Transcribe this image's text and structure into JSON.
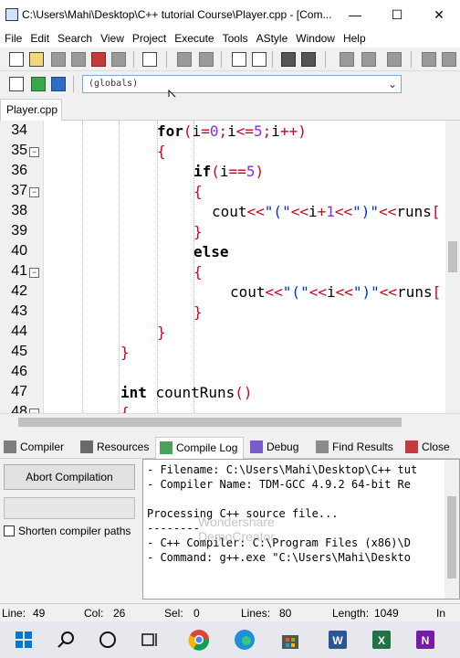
{
  "window": {
    "title": "C:\\Users\\Mahi\\Desktop\\C++ tutorial Course\\Player.cpp - [Com...",
    "minimize_glyph": "—",
    "maximize_glyph": "☐",
    "close_glyph": "✕"
  },
  "menu": [
    "File",
    "Edit",
    "Search",
    "View",
    "Project",
    "Execute",
    "Tools",
    "AStyle",
    "Window",
    "Help"
  ],
  "scope_selector": {
    "value": "(globals)"
  },
  "file_tab": {
    "label": "Player.cpp"
  },
  "editor": {
    "lines": [
      {
        "num": "34",
        "fold": false,
        "code": [
          [
            "kw",
            "for"
          ],
          [
            "sym",
            "("
          ],
          [
            "t",
            "i"
          ],
          [
            "sym",
            "="
          ],
          [
            "num",
            "0"
          ],
          [
            "sym",
            ";"
          ],
          [
            "t",
            "i"
          ],
          [
            "sym",
            "<="
          ],
          [
            "num",
            "5"
          ],
          [
            "sym",
            ";"
          ],
          [
            "t",
            "i"
          ],
          [
            "sym",
            "++)"
          ]
        ]
      },
      {
        "num": "35",
        "fold": true,
        "code": [
          [
            "sym",
            "{"
          ]
        ]
      },
      {
        "num": "36",
        "fold": false,
        "code": [
          [
            "kw",
            "if"
          ],
          [
            "sym",
            "("
          ],
          [
            "t",
            "i"
          ],
          [
            "sym",
            "=="
          ],
          [
            "num",
            "5"
          ],
          [
            "sym",
            ")"
          ]
        ]
      },
      {
        "num": "37",
        "fold": true,
        "code": [
          [
            "sym",
            "{"
          ]
        ]
      },
      {
        "num": "38",
        "fold": false,
        "code": [
          [
            "t",
            "cout"
          ],
          [
            "sym",
            "<<"
          ],
          [
            "str",
            "\"(\""
          ],
          [
            "sym",
            "<<"
          ],
          [
            "t",
            "i"
          ],
          [
            "sym",
            "+"
          ],
          [
            "num",
            "1"
          ],
          [
            "sym",
            "<<"
          ],
          [
            "str",
            "\")\""
          ],
          [
            "sym",
            "<<"
          ],
          [
            "t",
            "runs"
          ],
          [
            "sym",
            "["
          ]
        ]
      },
      {
        "num": "39",
        "fold": false,
        "code": [
          [
            "sym",
            "}"
          ]
        ]
      },
      {
        "num": "40",
        "fold": false,
        "code": [
          [
            "kw",
            "else"
          ]
        ]
      },
      {
        "num": "41",
        "fold": true,
        "code": [
          [
            "sym",
            "{"
          ]
        ]
      },
      {
        "num": "42",
        "fold": false,
        "code": [
          [
            "t",
            "cout"
          ],
          [
            "sym",
            "<<"
          ],
          [
            "str",
            "\"(\""
          ],
          [
            "sym",
            "<<"
          ],
          [
            "t",
            "i"
          ],
          [
            "sym",
            "<<"
          ],
          [
            "str",
            "\")\""
          ],
          [
            "sym",
            "<<"
          ],
          [
            "t",
            "runs"
          ],
          [
            "sym",
            "["
          ]
        ]
      },
      {
        "num": "43",
        "fold": false,
        "code": [
          [
            "sym",
            "}"
          ]
        ]
      },
      {
        "num": "44",
        "fold": false,
        "code": [
          [
            "sym",
            "}"
          ]
        ]
      },
      {
        "num": "45",
        "fold": false,
        "code": [
          [
            "sym",
            "}"
          ]
        ]
      },
      {
        "num": "46",
        "fold": false,
        "code": []
      },
      {
        "num": "47",
        "fold": false,
        "code": [
          [
            "kw",
            "int"
          ],
          [
            "t",
            " countRuns"
          ],
          [
            "sym",
            "()"
          ]
        ]
      },
      {
        "num": "48",
        "fold": true,
        "code": [
          [
            "sym",
            "{"
          ]
        ]
      }
    ]
  },
  "panel_tabs": [
    "Compiler",
    "Resources",
    "Compile Log",
    "Debug",
    "Find Results",
    "Close"
  ],
  "compile_panel": {
    "abort_label": "Abort Compilation",
    "shorten_label": "Shorten compiler paths"
  },
  "log_lines": [
    "- Filename: C:\\Users\\Mahi\\Desktop\\C++ tut",
    "- Compiler Name: TDM-GCC 4.9.2 64-bit Re",
    "",
    "Processing C++ source file...",
    "--------",
    "- C++ Compiler: C:\\Program Files (x86)\\D",
    "- Command: g++.exe \"C:\\Users\\Mahi\\Deskto"
  ],
  "watermark": {
    "line1": "Wondershare",
    "line2": "DemoCreator"
  },
  "status": {
    "line_label": "Line:",
    "line_value": "49",
    "col_label": "Col:",
    "col_value": "26",
    "sel_label": "Sel:",
    "sel_value": "0",
    "lines_label": "Lines:",
    "lines_value": "80",
    "length_label": "Length:",
    "length_value": "1049",
    "mode": "In"
  },
  "taskbar_icons": [
    "windows-start-icon",
    "search-icon",
    "cortana-icon",
    "task-view-icon",
    "chrome-icon",
    "edge-icon",
    "store-icon",
    "word-icon",
    "excel-icon",
    "onenote-icon"
  ]
}
